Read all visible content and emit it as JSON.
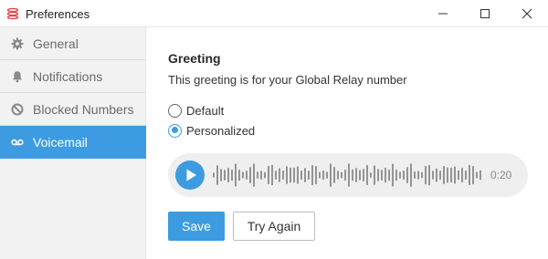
{
  "window": {
    "title": "Preferences",
    "icons": {
      "app": "app-logo-icon",
      "minimize": "minimize-icon",
      "maximize": "maximize-icon",
      "close": "close-icon"
    }
  },
  "sidebar": {
    "items": [
      {
        "label": "General",
        "icon": "gear-icon",
        "active": false
      },
      {
        "label": "Notifications",
        "icon": "bell-icon",
        "active": false
      },
      {
        "label": "Blocked Numbers",
        "icon": "blocked-icon",
        "active": false
      },
      {
        "label": "Voicemail",
        "icon": "voicemail-icon",
        "active": true
      }
    ]
  },
  "greeting": {
    "title": "Greeting",
    "subtitle": "This greeting is for your Global Relay number",
    "options": [
      {
        "label": "Default",
        "selected": false
      },
      {
        "label": "Personalized",
        "selected": true
      }
    ],
    "player": {
      "duration": "0:20",
      "icon": "play-icon"
    }
  },
  "actions": {
    "save_label": "Save",
    "try_again_label": "Try Again"
  },
  "colors": {
    "accent": "#3d9ce1",
    "sidebar_bg": "#f2f2f2"
  }
}
